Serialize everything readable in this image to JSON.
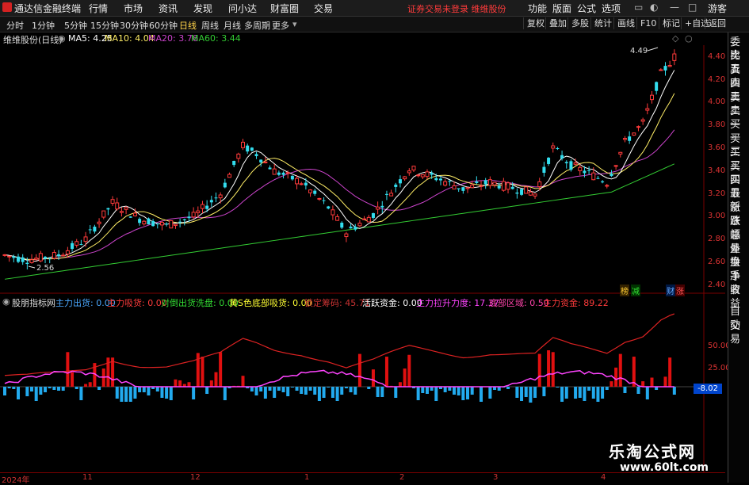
{
  "app": {
    "title": "通达信金融终端",
    "menus": [
      "行情",
      "市场",
      "资讯",
      "发现",
      "问小达",
      "财富圈",
      "交易"
    ],
    "notice": "证券交易未登录   维维股份",
    "right_menus": [
      "功能",
      "版面",
      "公式",
      "选项"
    ],
    "guest": "游客"
  },
  "toolbar": {
    "timeframes": [
      "分时",
      "1分钟",
      "5分钟",
      "15分钟",
      "30分钟",
      "60分钟",
      "日线",
      "周线",
      "月线",
      "多周期",
      "更多"
    ],
    "active_timeframe": "日线",
    "right_buttons": [
      "复权",
      "叠加",
      "多股",
      "统计",
      "画线",
      "F10",
      "标记",
      "+自选",
      "返回"
    ]
  },
  "stock": {
    "name": "维维股份(日线)",
    "ma5_label": "MA5: 4.25",
    "ma10_label": "MA10: 4.04",
    "ma20_label": "MA20: 3.76",
    "ma60_label": "MA60: 3.44",
    "high_annotation": "4.49",
    "low_annotation": "2.56"
  },
  "price_axis": [
    "4.40",
    "4.20",
    "4.00",
    "3.80",
    "3.60",
    "3.40",
    "3.20",
    "3.00",
    "2.80",
    "2.60",
    "2.40"
  ],
  "badges": [
    "榜",
    "减",
    "财",
    "涨"
  ],
  "indicator": {
    "name": "股朋指标网",
    "items": [
      {
        "label": "主力出货: 0.00",
        "color": "#4aa8ff"
      },
      {
        "label": "主力吸货: 0.00",
        "color": "#ff3b3b"
      },
      {
        "label": "对倒出货洗盘: 0.00",
        "color": "#33dd33"
      },
      {
        "label": "黄S色底部吸货: 0.00",
        "color": "#ffff33"
      },
      {
        "label": "锁定筹码: 45.71",
        "color": "#cc3333"
      },
      {
        "label": "活跃资金: 0.00",
        "color": "#ffffff"
      },
      {
        "label": "主力拉升力度: 17.37",
        "color": "#ff44ff"
      },
      {
        "label": "底部区域: 0.50",
        "color": "#ff44aa"
      },
      {
        "label": "主力资金: 89.22",
        "color": "#ff3b3b"
      }
    ],
    "axis": [
      "50.00",
      "25.00"
    ],
    "current_value": "-8.02"
  },
  "date_axis": [
    "2024年",
    "11",
    "12",
    "1",
    "2",
    "3",
    "4"
  ],
  "sidebar": {
    "items": [
      "委比",
      "卖五",
      "卖四",
      "卖三",
      "卖二",
      "卖一",
      "买一",
      "买二",
      "买三",
      "买四",
      "买五",
      "最新",
      "涨跌",
      "涨幅",
      "总量",
      "外盘",
      "换手",
      "净资",
      "收益"
    ],
    "bottom_items": [
      "自动",
      "交易"
    ]
  },
  "watermark": {
    "line1": "乐淘公式网",
    "line2": "www.60lt.com"
  },
  "colors": {
    "up": "#ff3b3b",
    "down": "#33ddee",
    "ma5": "#ffffff",
    "ma10": "#ffee66",
    "ma20": "#cc44cc",
    "ma60": "#33cc33",
    "lock_line": "#dd2222"
  }
}
